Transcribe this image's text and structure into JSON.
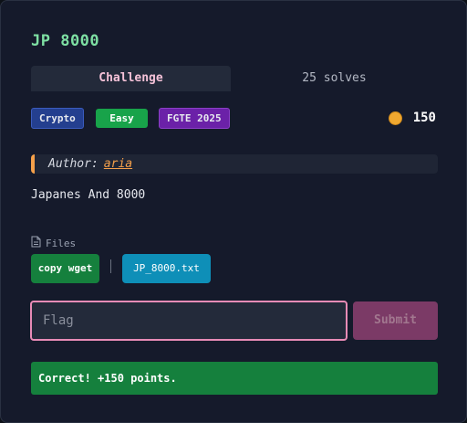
{
  "challenge": {
    "title": "JP 8000",
    "tabs": [
      {
        "label": "Challenge",
        "active": true
      },
      {
        "label": "25 solves",
        "active": false
      }
    ],
    "tags": [
      {
        "label": "Crypto",
        "color": "#243f8f"
      },
      {
        "label": "Easy",
        "color": "#18a34a"
      },
      {
        "label": "FGTE 2025",
        "color": "#6b21a8"
      }
    ],
    "points": "150",
    "points_icon": "coin-icon",
    "author_label": "Author:",
    "author_name": "aria",
    "description": "Japanes And 8000",
    "files_label": "Files",
    "files_icon": "file-icon",
    "copy_wget_label": "copy wget",
    "file_name": "JP_8000.txt"
  },
  "submission": {
    "flag_placeholder": "Flag",
    "flag_value": "",
    "submit_label": "Submit",
    "result_message": "Correct! +150 points.",
    "result_color": "#15803d"
  },
  "colors": {
    "accent_title": "#7ee0a3",
    "input_border": "#e88bb6",
    "author_accent": "#f5a04a"
  }
}
